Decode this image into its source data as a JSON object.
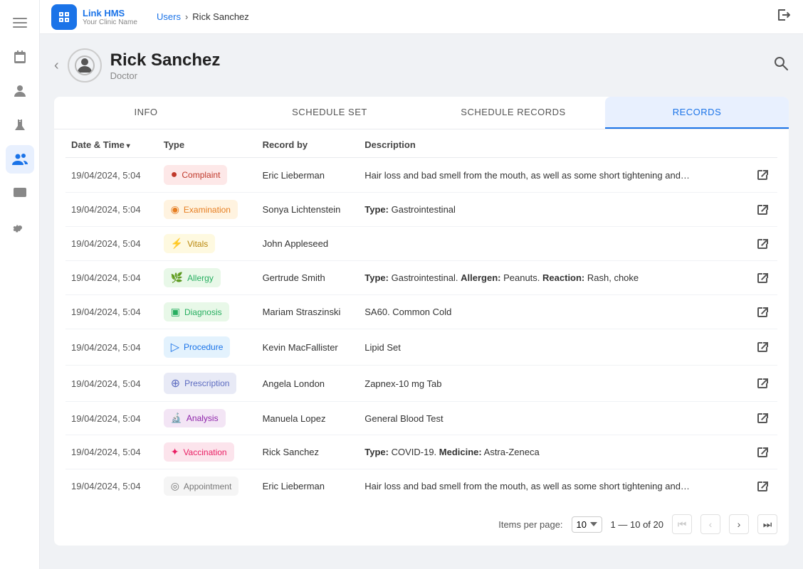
{
  "app": {
    "name": "Link HMS",
    "tagline": "Your Clinic Name"
  },
  "nav": {
    "breadcrumb1": "Users",
    "separator": "›",
    "breadcrumb2": "Rick Sanchez"
  },
  "profile": {
    "name": "Rick Sanchez",
    "role": "Doctor"
  },
  "tabs": [
    {
      "id": "info",
      "label": "INFO"
    },
    {
      "id": "schedule_set",
      "label": "SCHEDULE SET"
    },
    {
      "id": "schedule_records",
      "label": "SCHEDULE RECORDS"
    },
    {
      "id": "records",
      "label": "RECORDS"
    }
  ],
  "table": {
    "headers": {
      "datetime": "Date & Time",
      "type": "Type",
      "record_by": "Record by",
      "description": "Description"
    },
    "rows": [
      {
        "datetime": "19/04/2024, 5:04",
        "type": "Complaint",
        "type_class": "complaint",
        "type_icon": "🔴",
        "record_by": "Eric Lieberman",
        "description": "Hair loss and bad smell from the mouth, as well as some short tightening and…"
      },
      {
        "datetime": "19/04/2024, 5:04",
        "type": "Examination",
        "type_class": "examination",
        "type_icon": "👁",
        "record_by": "Sonya Lichtenstein",
        "description": "<b>Type:</b> Gastrointestinal"
      },
      {
        "datetime": "19/04/2024, 5:04",
        "type": "Vitals",
        "type_class": "vitals",
        "type_icon": "⚡",
        "record_by": "John Appleseed",
        "description": ""
      },
      {
        "datetime": "19/04/2024, 5:04",
        "type": "Allergy",
        "type_class": "allergy",
        "type_icon": "🌿",
        "record_by": "Gertrude Smith",
        "description": "<b>Type:</b> Gastrointestinal. <b>Allergen:</b> Peanuts. <b>Reaction:</b> Rash, choke"
      },
      {
        "datetime": "19/04/2024, 5:04",
        "type": "Diagnosis",
        "type_class": "diagnosis",
        "type_icon": "📋",
        "record_by": "Mariam Straszinski",
        "description": "SA60. Common Cold"
      },
      {
        "datetime": "19/04/2024, 5:04",
        "type": "Procedure",
        "type_class": "procedure",
        "type_icon": "💉",
        "record_by": "Kevin MacFallister",
        "description": "Lipid Set"
      },
      {
        "datetime": "19/04/2024, 5:04",
        "type": "Prescription",
        "type_class": "prescription",
        "type_icon": "💊",
        "record_by": "Angela London",
        "description": "Zapnex-10 mg Tab"
      },
      {
        "datetime": "19/04/2024, 5:04",
        "type": "Analysis",
        "type_class": "analysis",
        "type_icon": "🔬",
        "record_by": "Manuela Lopez",
        "description": "General Blood Test"
      },
      {
        "datetime": "19/04/2024, 5:04",
        "type": "Vaccination",
        "type_class": "vaccination",
        "type_icon": "💉",
        "record_by": "Rick Sanchez",
        "description": "<b>Type:</b> COVID-19. <b>Medicine:</b> Astra-Zeneca"
      },
      {
        "datetime": "19/04/2024, 5:04",
        "type": "Appointment",
        "type_class": "appointment",
        "type_icon": "📅",
        "record_by": "Eric Lieberman",
        "description": "Hair loss and bad smell from the mouth, as well as some short tightening and…"
      }
    ]
  },
  "pagination": {
    "items_per_page_label": "Items per page:",
    "items_per_page": "10",
    "range": "1 — 10 of 20"
  },
  "sidebar": {
    "icons": [
      {
        "id": "menu",
        "symbol": "☰"
      },
      {
        "id": "calendar",
        "symbol": "📅"
      },
      {
        "id": "person",
        "symbol": "👤"
      },
      {
        "id": "flask",
        "symbol": "⚗️"
      },
      {
        "id": "users",
        "symbol": "👥"
      },
      {
        "id": "monitor",
        "symbol": "🖥"
      },
      {
        "id": "settings",
        "symbol": "⚙️"
      }
    ]
  },
  "badge_icons": {
    "complaint": "●",
    "examination": "◉",
    "vitals": "⚡",
    "allergy": "🌿",
    "diagnosis": "▣",
    "procedure": "▷",
    "prescription": "⊕",
    "analysis": "◈",
    "vaccination": "✦",
    "appointment": "◎"
  }
}
